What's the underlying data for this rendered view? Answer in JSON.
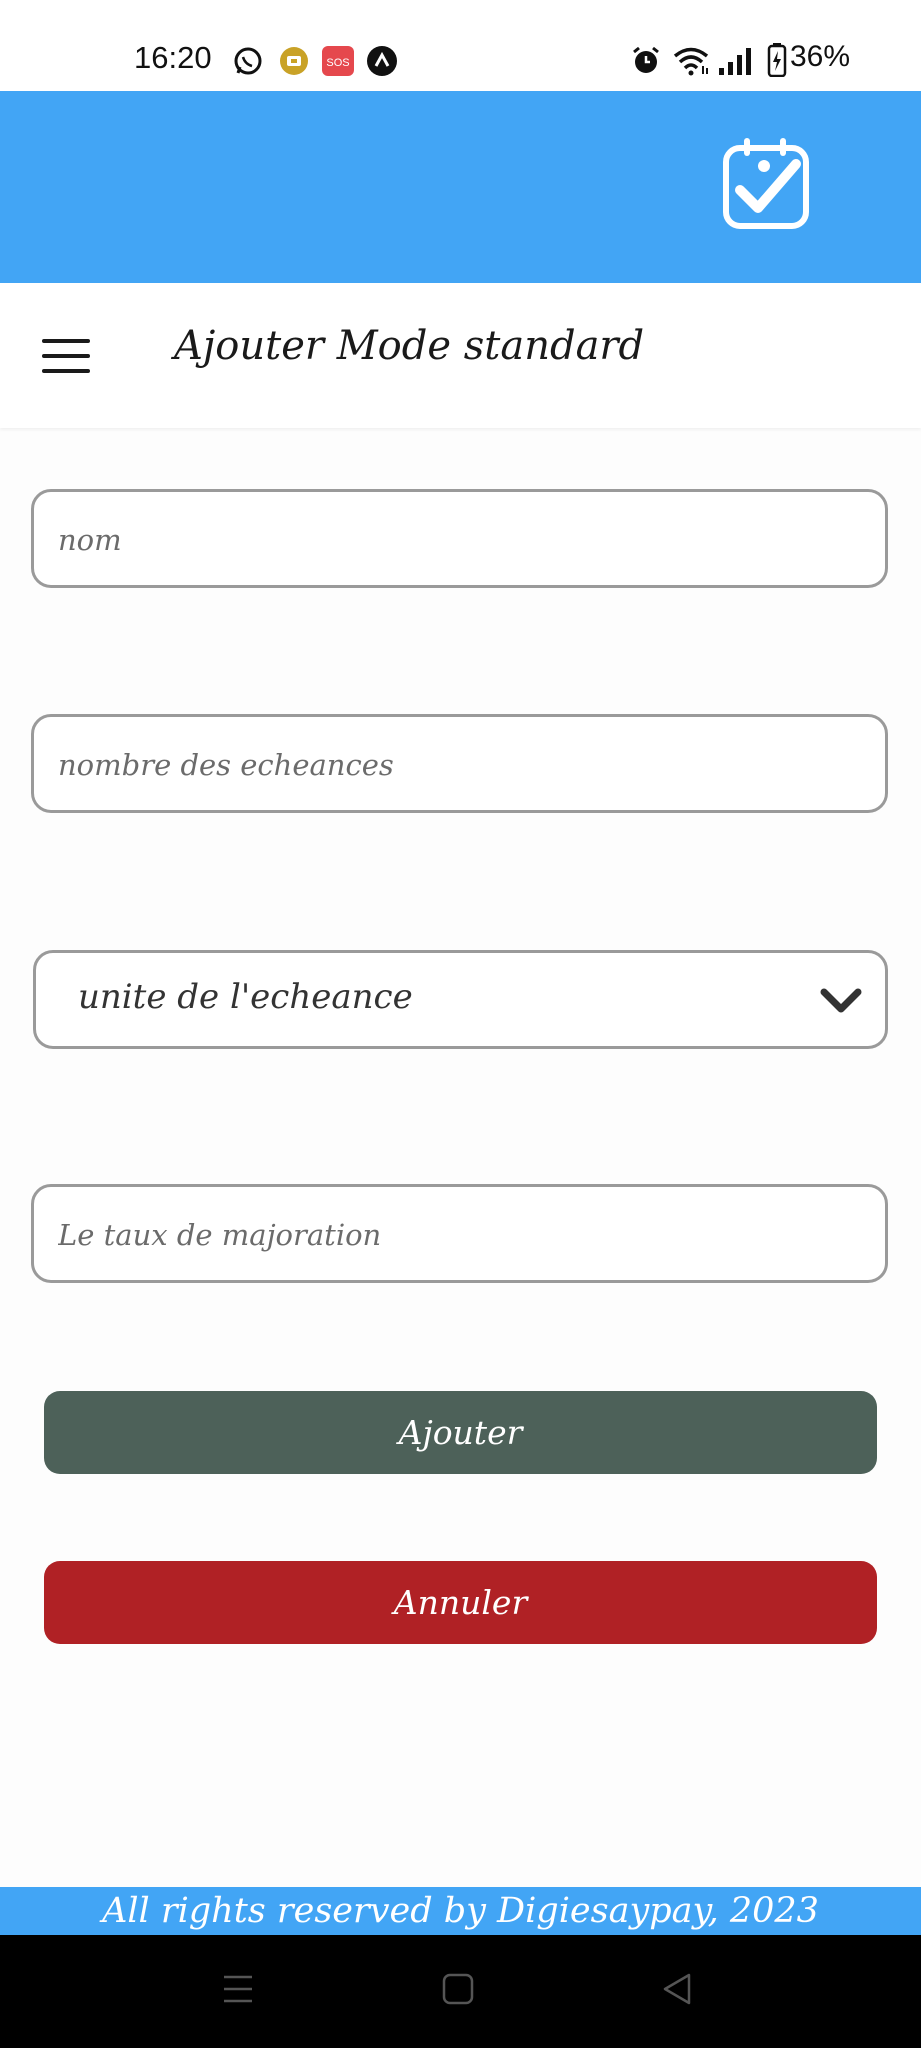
{
  "status_bar": {
    "time": "16:20",
    "battery": "36%",
    "icons": [
      "whatsapp-icon",
      "game-icon",
      "sos-icon",
      "vpn-icon",
      "alarm-icon",
      "wifi-icon",
      "signal-icon",
      "battery-icon"
    ],
    "sos_label": "SOS"
  },
  "header": {
    "logo_icon": "calendar-check-icon",
    "background": "#42a5f5"
  },
  "title_bar": {
    "menu_icon": "hamburger-menu-icon",
    "title": "Ajouter Mode standard"
  },
  "form": {
    "nom": {
      "value": "",
      "placeholder": "nom"
    },
    "nombre_echeances": {
      "value": "",
      "placeholder": "nombre des echeances"
    },
    "unite_echeance": {
      "selected": "unite de l'echeance"
    },
    "taux_majoration": {
      "value": "",
      "placeholder": "Le taux de majoration"
    }
  },
  "buttons": {
    "add_label": "Ajouter",
    "add_color": "#4d6159",
    "cancel_label": "Annuler",
    "cancel_color": "#b02125"
  },
  "footer": {
    "text": "All rights reserved by Digiesaypay, 2023"
  },
  "nav_bar": {
    "icons": [
      "recent-apps-icon",
      "home-icon",
      "back-icon"
    ]
  }
}
